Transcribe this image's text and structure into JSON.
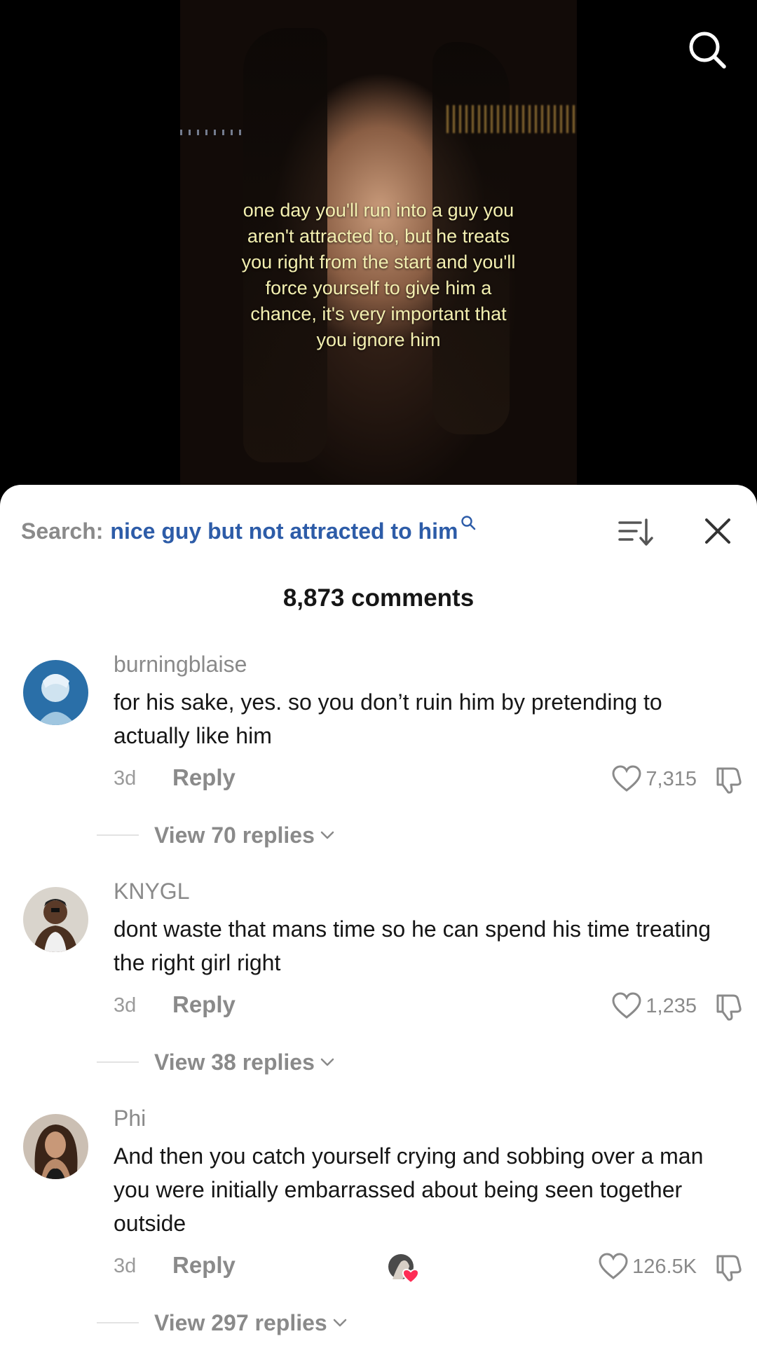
{
  "video": {
    "caption": "one day you'll run into a guy you aren't attracted to, but he treats you right from the start and you'll force yourself to give him a chance, it's very important that you ignore him",
    "search_icon": "search-icon"
  },
  "comments_sheet": {
    "search_prefix": "Search:",
    "search_query": "nice guy but not attracted to him",
    "sort_icon": "sort-icon",
    "close_icon": "close-icon",
    "comment_count": "8,873 comments",
    "accent_color": "#2d5ca8",
    "like_color": "#fe2c55",
    "comments": [
      {
        "username": "burningblaise",
        "text": "for his sake, yes. so you don’t ruin him by pretending to actually like him",
        "time": "3d",
        "reply_label": "Reply",
        "likes": "7,315",
        "view_replies": "View 70 replies",
        "creator_liked": false
      },
      {
        "username": "KNYGL",
        "text": "dont waste that mans time so he can spend his time treating the right girl right",
        "time": "3d",
        "reply_label": "Reply",
        "likes": "1,235",
        "view_replies": "View 38 replies",
        "creator_liked": false
      },
      {
        "username": "Phi",
        "text": "And then you catch yourself crying and sobbing over a man you were initially embarrassed about being seen together outside",
        "time": "3d",
        "reply_label": "Reply",
        "likes": "126.5K",
        "view_replies": "View 297 replies",
        "creator_liked": true
      }
    ]
  }
}
